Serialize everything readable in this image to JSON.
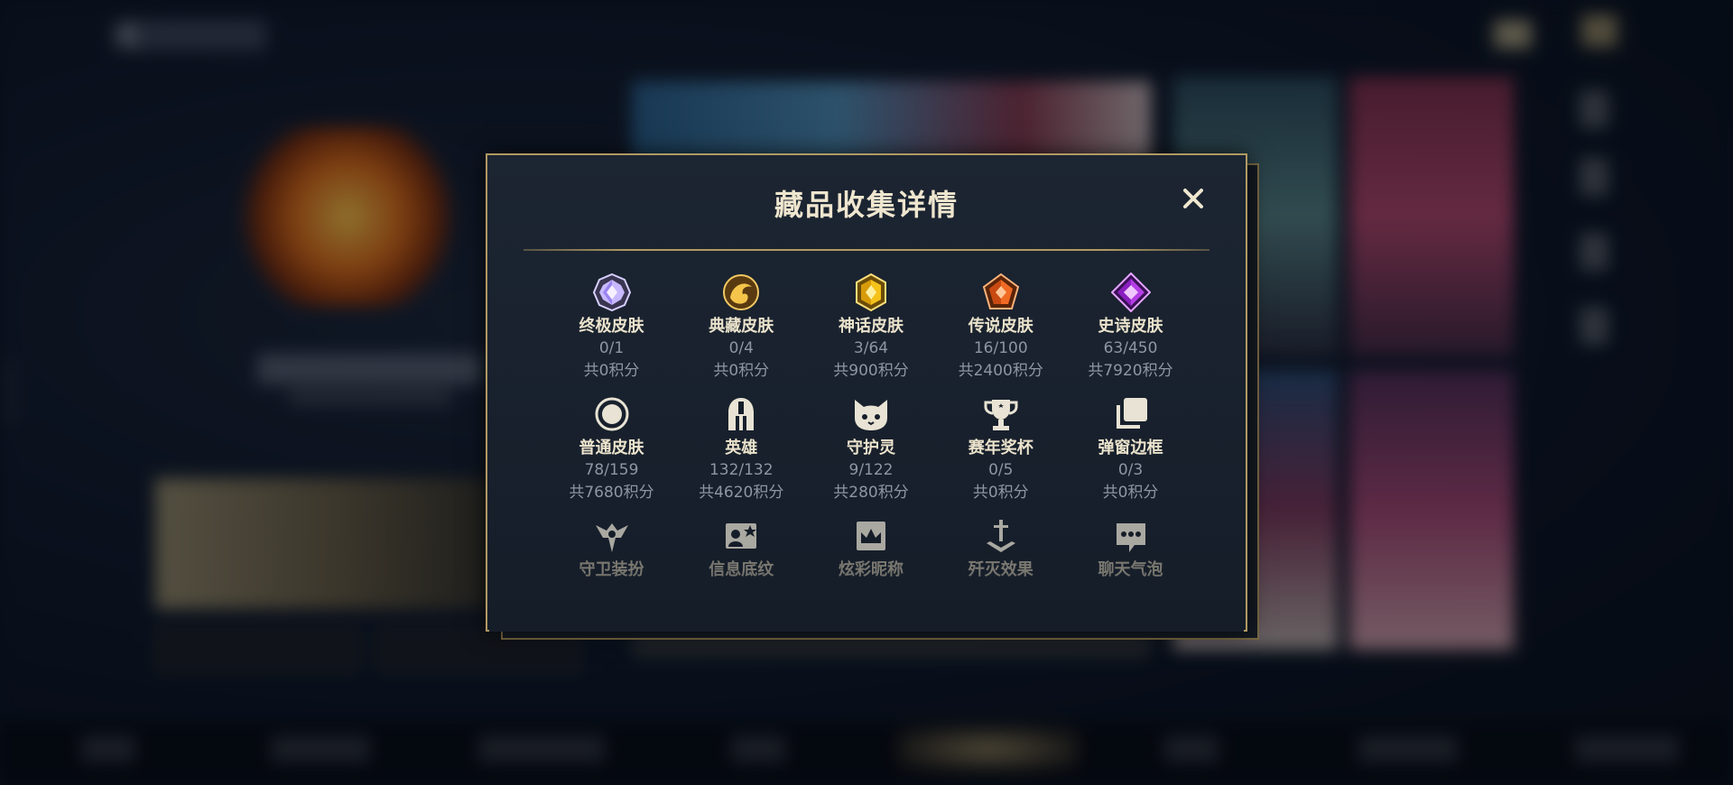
{
  "modal": {
    "title": "藏品收集详情",
    "close_label": "close"
  },
  "collections": [
    {
      "label": "终极皮肤",
      "count": "0/1",
      "points": "共0积分",
      "icon": "ultimate-skin-gem-icon",
      "color": "#b9a6f5"
    },
    {
      "label": "典藏皮肤",
      "count": "0/4",
      "points": "共0积分",
      "icon": "prestige-skin-dragon-icon",
      "color": "#d7a533"
    },
    {
      "label": "神话皮肤",
      "count": "3/64",
      "points": "共900积分",
      "icon": "mythic-skin-gem-icon",
      "color": "#f2c21b"
    },
    {
      "label": "传说皮肤",
      "count": "16/100",
      "points": "共2400积分",
      "icon": "legendary-skin-gem-icon",
      "color": "#f06a24"
    },
    {
      "label": "史诗皮肤",
      "count": "63/450",
      "points": "共7920积分",
      "icon": "epic-skin-gem-icon",
      "color": "#b53ee6"
    },
    {
      "label": "普通皮肤",
      "count": "78/159",
      "points": "共7680积分",
      "icon": "normal-skin-circle-icon",
      "color": "#e8e3d4"
    },
    {
      "label": "英雄",
      "count": "132/132",
      "points": "共4620积分",
      "icon": "champion-helmet-icon",
      "color": "#e8e3d4"
    },
    {
      "label": "守护灵",
      "count": "9/122",
      "points": "共280积分",
      "icon": "guardian-pet-icon",
      "color": "#e8e3d4"
    },
    {
      "label": "赛年奖杯",
      "count": "0/5",
      "points": "共0积分",
      "icon": "season-trophy-icon",
      "color": "#e8e3d4"
    },
    {
      "label": "弹窗边框",
      "count": "0/3",
      "points": "共0积分",
      "icon": "popup-frame-icon",
      "color": "#e8e3d4"
    },
    {
      "label": "守卫装扮",
      "icon": "ward-skin-icon",
      "color": "#e8e3d4"
    },
    {
      "label": "信息底纹",
      "icon": "info-card-icon",
      "color": "#e8e3d4"
    },
    {
      "label": "炫彩昵称",
      "icon": "colorful-nickname-icon",
      "color": "#e8e3d4"
    },
    {
      "label": "歼灭效果",
      "icon": "elimination-effect-icon",
      "color": "#e8e3d4"
    },
    {
      "label": "聊天气泡",
      "icon": "chat-bubble-icon",
      "color": "#e8e3d4"
    }
  ],
  "colors": {
    "modal_border": "#b09a62",
    "modal_bg": "#1a2330",
    "text_primary": "#ebe3cc",
    "text_secondary": "#8d96a4"
  }
}
